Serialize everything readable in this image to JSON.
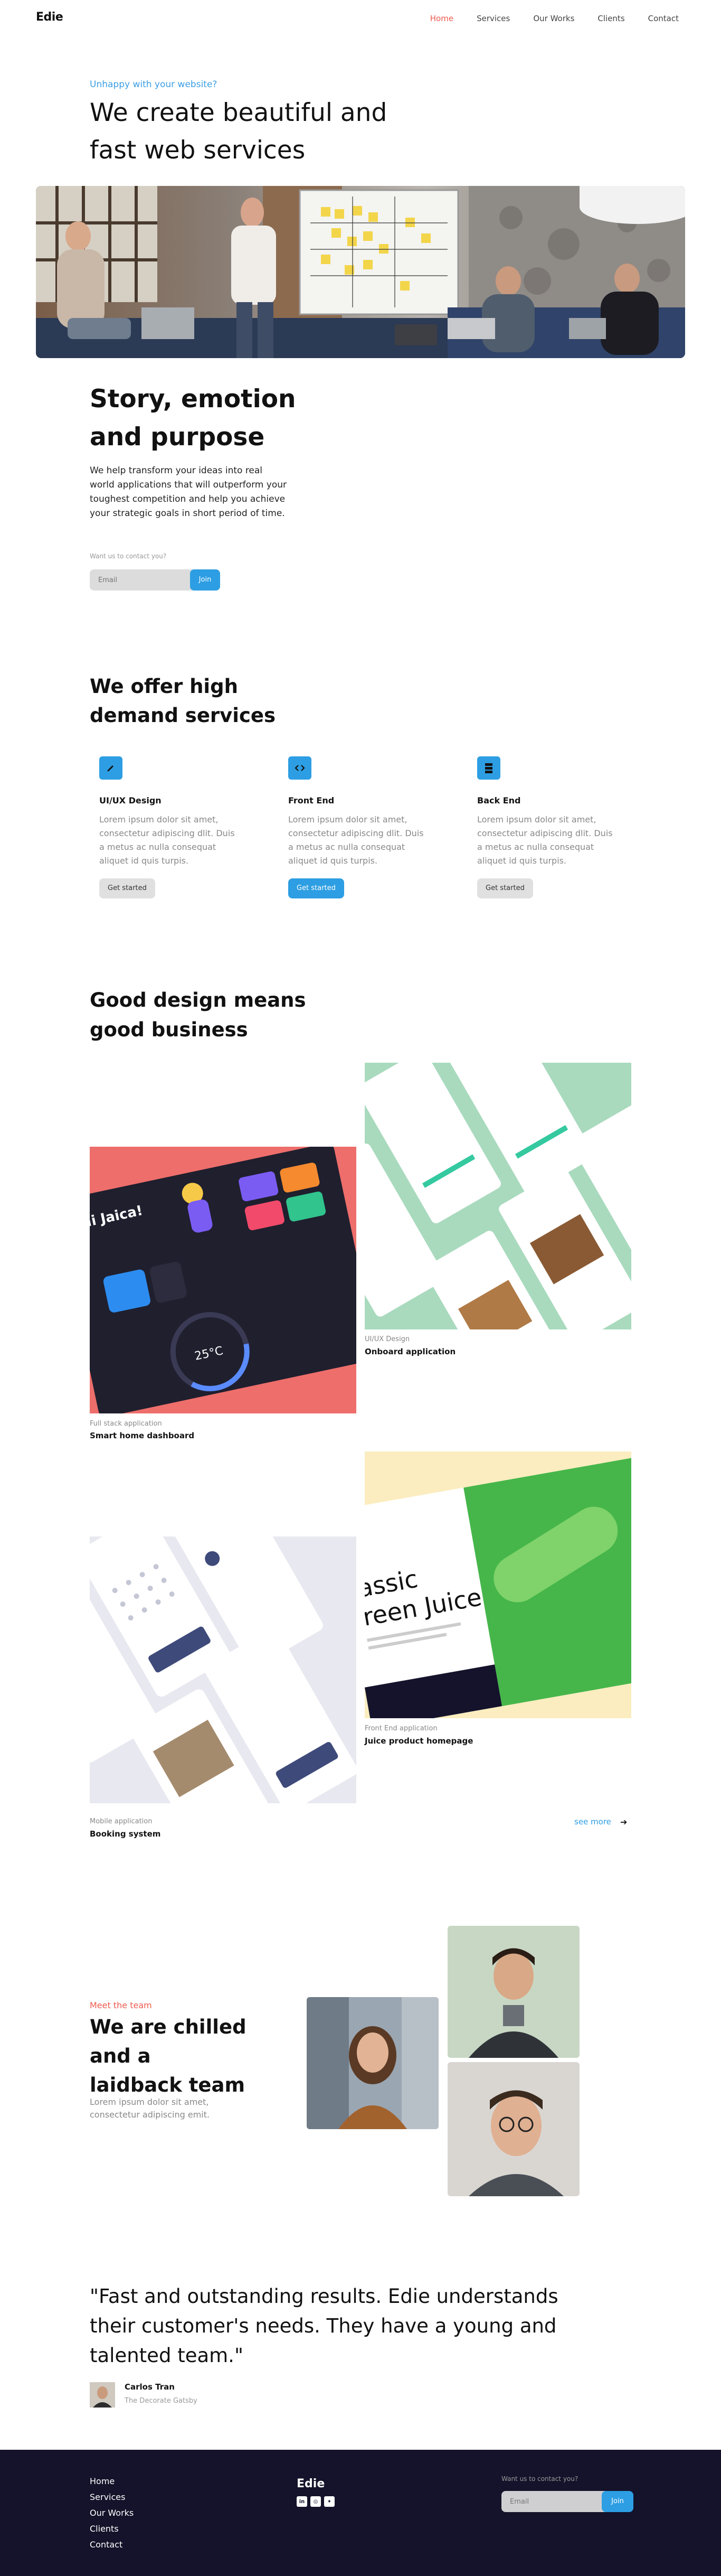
{
  "nav": {
    "logo": "Edie",
    "links": [
      "Home",
      "Services",
      "Our Works",
      "Clients",
      "Contact"
    ],
    "active_index": 0
  },
  "hero": {
    "eyebrow": "Unhappy with your website?",
    "title": "We create beautiful and fast web services"
  },
  "story": {
    "title": "Story, emotion and purpose",
    "text": "We help transform your ideas into real world applications that will outperform your toughest competition and help you achieve your strategic goals in short period of time.",
    "contact_label": "Want us to contact you?",
    "email_placeholder": "Email",
    "join_label": "Join"
  },
  "services": {
    "title": "We offer high demand services",
    "items": [
      {
        "icon": "pencil-icon",
        "title": "UI/UX Design",
        "text": "Lorem ipsum dolor sit amet, consectetur adipiscing dlit. Duis a metus ac nulla consequat aliquet id quis turpis.",
        "button": "Get started",
        "active": false
      },
      {
        "icon": "code-icon",
        "title": "Front End",
        "text": "Lorem ipsum dolor sit amet, consectetur adipiscing dlit. Duis a metus ac nulla consequat aliquet id quis turpis.",
        "button": "Get started",
        "active": true
      },
      {
        "icon": "server-icon",
        "title": "Back End",
        "text": "Lorem ipsum dolor sit amet, consectetur adipiscing dlit. Duis a metus ac nulla consequat aliquet id quis turpis.",
        "button": "Get started",
        "active": false
      }
    ]
  },
  "works": {
    "title": "Good design means good business",
    "items": [
      {
        "category": "UI/UX Design",
        "name": "Onboard application"
      },
      {
        "category": "Full stack application",
        "name": "Smart home dashboard"
      },
      {
        "category": "Front End application",
        "name": "Juice product homepage"
      },
      {
        "category": "Mobile application",
        "name": "Booking system"
      }
    ],
    "mockups": {
      "dashboard_greeting": "Hi Jaica!",
      "dashboard_temp": "25°C",
      "juice_heading_1": "assic",
      "juice_heading_2": "reen Juice"
    },
    "see_more": "see more"
  },
  "team": {
    "eyebrow": "Meet the team",
    "title": "We are chilled and a laidback team",
    "text": "Lorem ipsum dolor sit amet, consectetur adipiscing emit."
  },
  "testimonial": {
    "quote": "\"Fast and outstanding results. Edie understands their customer's needs. They have a young and talented team.\"",
    "name": "Carlos Tran",
    "company": "The Decorate Gatsby"
  },
  "footer": {
    "links": [
      "Home",
      "Services",
      "Our Works",
      "Clients",
      "Contact"
    ],
    "logo": "Edie",
    "social": [
      "linkedin-icon",
      "instagram-icon",
      "twitter-icon"
    ],
    "contact_label": "Want us to contact you?",
    "email_placeholder": "Email",
    "join_label": "Join"
  },
  "colors": {
    "accent_blue": "#2d9ee3",
    "accent_red": "#ef5a4f",
    "footer_bg": "#14132b"
  }
}
